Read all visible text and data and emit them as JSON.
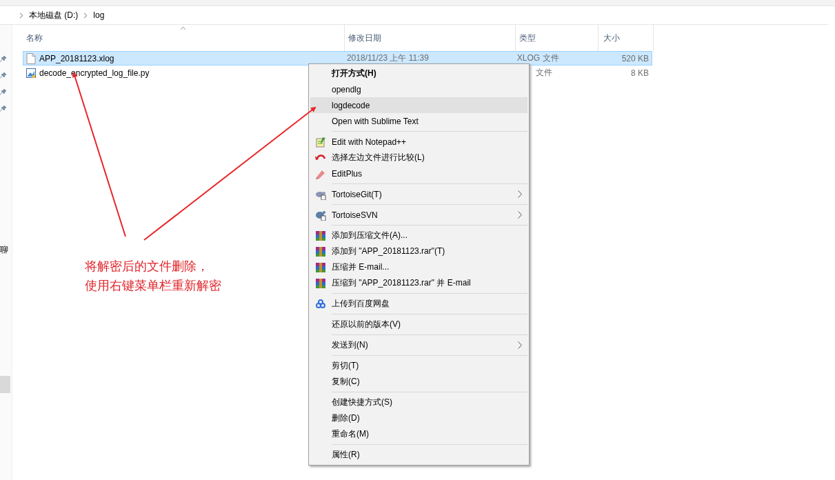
{
  "breadcrumb": [
    "本地磁盘 (D:)",
    "log"
  ],
  "nav_pane": {
    "partial_label": "聊"
  },
  "columns": [
    {
      "label": "名称",
      "sorted": true
    },
    {
      "label": "修改日期",
      "sorted": false
    },
    {
      "label": "类型",
      "sorted": false
    },
    {
      "label": "大小",
      "sorted": false
    }
  ],
  "files": [
    {
      "name": "APP_20181123.xlog",
      "kind": "doc",
      "date": "2018/11/23 上午 11:39",
      "type": "XLOG 文件",
      "size": "520 KB",
      "selected": true
    },
    {
      "name": "decode_encrypted_log_file.py",
      "kind": "py",
      "type": "文件",
      "type_partly_hidden": true,
      "size": "8 KB",
      "selected": false
    }
  ],
  "context_menu": {
    "groups": [
      [
        {
          "label": "打开方式(H)",
          "kind": "plain",
          "bold": true,
          "selected": false,
          "submenu": false
        },
        {
          "label": "opendlg",
          "kind": "plain",
          "bold": false,
          "selected": false,
          "submenu": false
        },
        {
          "label": "logdecode",
          "kind": "plain",
          "bold": false,
          "selected": true,
          "submenu": false
        },
        {
          "label": "Open with Sublime Text",
          "kind": "plain",
          "bold": false,
          "selected": false,
          "submenu": false
        }
      ],
      [
        {
          "label": "Edit with Notepad++",
          "kind": "notepad",
          "bold": false,
          "selected": false,
          "submenu": false
        },
        {
          "label": "选择左边文件进行比较(L)",
          "kind": "compare",
          "bold": false,
          "selected": false,
          "submenu": false
        },
        {
          "label": "EditPlus",
          "kind": "editplus",
          "bold": false,
          "selected": false,
          "submenu": false
        }
      ],
      [
        {
          "label": "TortoiseGit(T)",
          "kind": "git",
          "bold": false,
          "selected": false,
          "submenu": true
        }
      ],
      [
        {
          "label": "TortoiseSVN",
          "kind": "svn",
          "bold": false,
          "selected": false,
          "submenu": true
        }
      ],
      [
        {
          "label": "添加到压缩文件(A)...",
          "kind": "archive",
          "bold": false,
          "selected": false,
          "submenu": false
        },
        {
          "label": "添加到 \"APP_20181123.rar\"(T)",
          "kind": "archive",
          "bold": false,
          "selected": false,
          "submenu": false
        },
        {
          "label": "压缩并 E-mail...",
          "kind": "archive",
          "bold": false,
          "selected": false,
          "submenu": false
        },
        {
          "label": "压缩到 \"APP_20181123.rar\" 并 E-mail",
          "kind": "archive",
          "bold": false,
          "selected": false,
          "submenu": false
        }
      ],
      [
        {
          "label": "上传到百度网盘",
          "kind": "cloud",
          "bold": false,
          "selected": false,
          "submenu": false
        }
      ],
      [
        {
          "label": "还原以前的版本(V)",
          "kind": "plain",
          "bold": false,
          "selected": false,
          "submenu": false
        }
      ],
      [
        {
          "label": "发送到(N)",
          "kind": "plain",
          "bold": false,
          "selected": false,
          "submenu": true
        }
      ],
      [
        {
          "label": "剪切(T)",
          "kind": "plain",
          "bold": false,
          "selected": false,
          "submenu": false
        },
        {
          "label": "复制(C)",
          "kind": "plain",
          "bold": false,
          "selected": false,
          "submenu": false
        }
      ],
      [
        {
          "label": "创建快捷方式(S)",
          "kind": "plain",
          "bold": false,
          "selected": false,
          "submenu": false
        },
        {
          "label": "删除(D)",
          "kind": "plain",
          "bold": false,
          "selected": false,
          "submenu": false
        },
        {
          "label": "重命名(M)",
          "kind": "plain",
          "bold": false,
          "selected": false,
          "submenu": false
        }
      ],
      [
        {
          "label": "属性(R)",
          "kind": "plain",
          "bold": false,
          "selected": false,
          "submenu": false
        }
      ]
    ]
  },
  "annotation": {
    "lines": [
      "将解密后的文件删除，",
      "使用右键菜单栏重新解密"
    ]
  }
}
